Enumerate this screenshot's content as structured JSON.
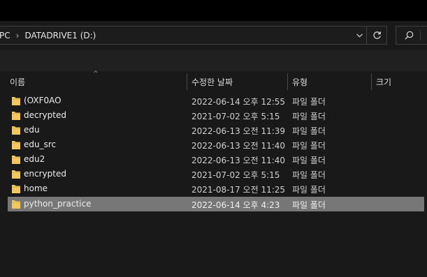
{
  "address": {
    "crumbs": [
      "PC",
      "DATADRIVE1 (D:)"
    ]
  },
  "columns": {
    "name": "이름",
    "date": "수정한 날짜",
    "type": "유형",
    "size": "크기"
  },
  "files": [
    {
      "name": "(OXF0AO",
      "date": "2022-06-14 오후 12:55",
      "type": "파일 폴더",
      "selected": false
    },
    {
      "name": "decrypted",
      "date": "2021-07-02 오후 5:15",
      "type": "파일 폴더",
      "selected": false
    },
    {
      "name": "edu",
      "date": "2022-06-13 오전 11:39",
      "type": "파일 폴더",
      "selected": false
    },
    {
      "name": "edu_src",
      "date": "2022-06-13 오전 11:40",
      "type": "파일 폴더",
      "selected": false
    },
    {
      "name": "edu2",
      "date": "2022-06-13 오전 11:40",
      "type": "파일 폴더",
      "selected": false
    },
    {
      "name": "encrypted",
      "date": "2021-07-02 오후 5:15",
      "type": "파일 폴더",
      "selected": false
    },
    {
      "name": "home",
      "date": "2021-08-17 오전 11:25",
      "type": "파일 폴더",
      "selected": false
    },
    {
      "name": "python_practice",
      "date": "2022-06-14 오후 4:23",
      "type": "파일 폴더",
      "selected": true
    }
  ],
  "icons": {
    "address_dropdown": "chevron-down-icon",
    "refresh": "refresh-icon",
    "search": "search-icon",
    "folder": "folder-icon"
  },
  "colors": {
    "background": "#191919",
    "selection": "#777777",
    "folder": "#f2c75c"
  }
}
